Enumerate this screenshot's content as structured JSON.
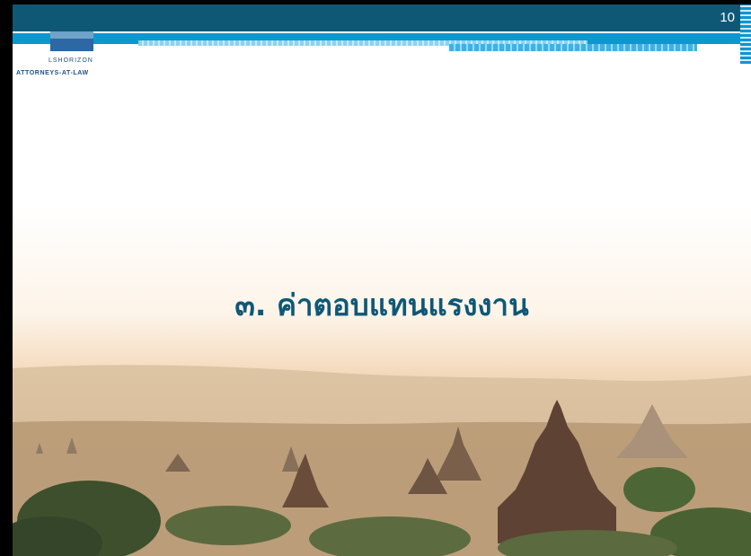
{
  "slide": {
    "page_number": "10",
    "title": "๓. ค่าตอบแทนแรงงาน"
  },
  "logo": {
    "brand": "LSHORIZON",
    "tagline": "ATTORNEYS-AT-LAW"
  },
  "colors": {
    "header_dark": "#0e5876",
    "header_blue": "#0c97cf",
    "title_text": "#0e5876"
  },
  "background": {
    "icon": "temple-landscape-photo"
  }
}
